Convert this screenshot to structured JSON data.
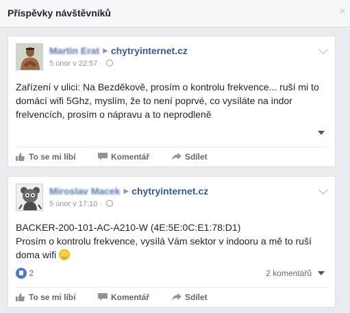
{
  "panel": {
    "title": "Příspěvky návštěvníků",
    "close_glyph": "×"
  },
  "posts": [
    {
      "author": "Martin Erat",
      "page": "chytryinternet.cz",
      "date": "5 únor v 22:57",
      "text": "Zařízení v ulici: Na Bezděkově, prosím o kontrolu frekvence... ruší mi to domácí wifi 5Ghz, myslím, že to není poprvé, co vysíláte na indor frelvencích, prosím o nápravu a to neprodleně",
      "actions": {
        "like": "To se mi líbí",
        "comment": "Komentář",
        "share": "Sdílet"
      }
    },
    {
      "author": "Miroslav Macek",
      "page": "chytryinternet.cz",
      "date": "5 únor v 17:10",
      "text_line1": "BACKER-200-101-AC-A210-W (4E:5E:0C:E1:78:D1)",
      "text_line2": "Prosím o kontrolu frekvence, vysílá Vám sektor v indooru a mě to ruší doma wifi",
      "like_count": "2",
      "comments": "2 komentářů",
      "actions": {
        "like": "To se mi líbí",
        "comment": "Komentář",
        "share": "Sdílet"
      }
    }
  ],
  "colors": {
    "link": "#365899",
    "muted": "#90949c",
    "bg": "#e9ebee",
    "like_blue": "#4a76d2"
  }
}
